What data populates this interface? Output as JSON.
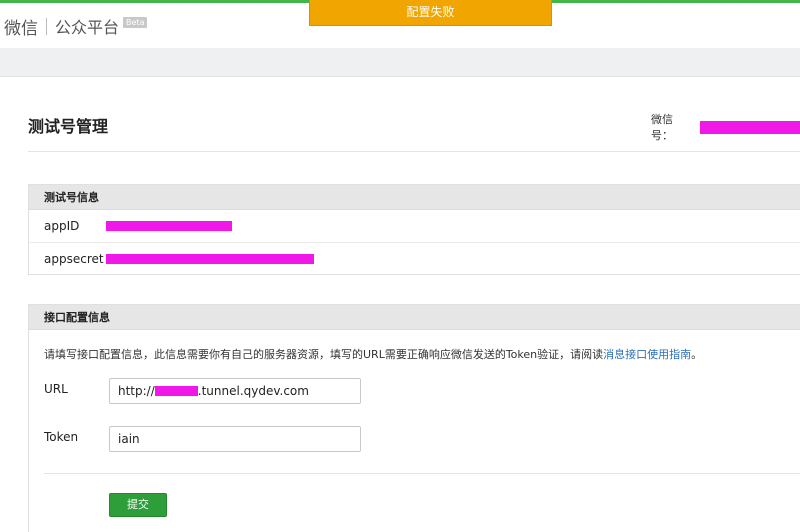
{
  "toast": {
    "message": "配置失败"
  },
  "header": {
    "brand": "微信",
    "product": "公众平台",
    "badge": "Beta"
  },
  "page": {
    "title": "测试号管理",
    "wechat_id_label": "微信号："
  },
  "test_account": {
    "section_title": "测试号信息",
    "rows": [
      {
        "label": "appID"
      },
      {
        "label": "appsecret"
      }
    ]
  },
  "interface_config": {
    "section_title": "接口配置信息",
    "description": "请填写接口配置信息，此信息需要你有自己的服务器资源，填写的URL需要正确响应微信发送的Token验证，请阅读",
    "link_text": "消息接口使用指南",
    "description_end": "。",
    "url": {
      "label": "URL",
      "value_prefix": "http://",
      "value_suffix": ".tunnel.qydev.com"
    },
    "token": {
      "label": "Token",
      "value": "iain"
    },
    "submit_label": "提交"
  },
  "colors": {
    "accent": "#44b549",
    "toast": "#f0a500",
    "submit": "#2e9e3a",
    "link": "#2d6fb6",
    "redaction": "#f018e8"
  }
}
